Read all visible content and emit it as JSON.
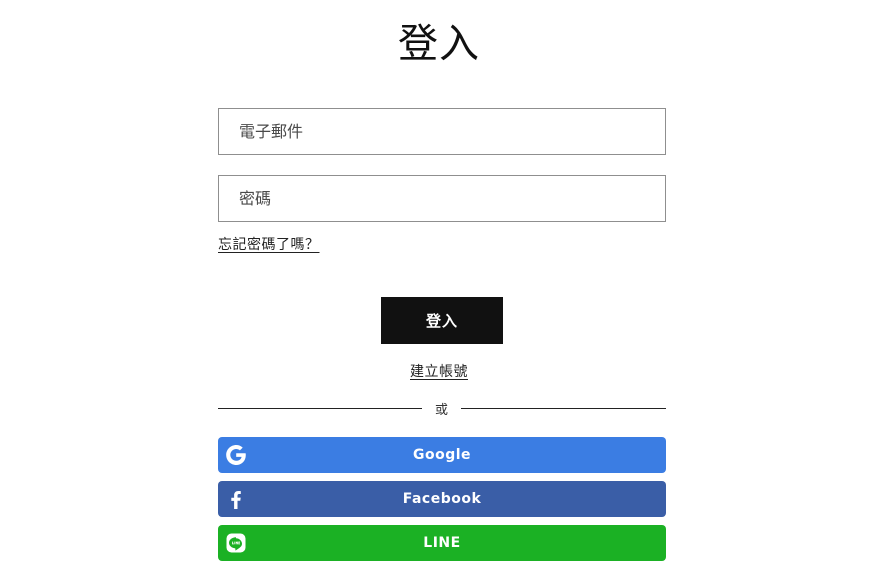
{
  "page": {
    "title": "登入"
  },
  "form": {
    "email_placeholder": "電子郵件",
    "password_placeholder": "密碼",
    "forgot_password": "忘記密碼了嗎？",
    "login_button": "登入",
    "create_account": "建立帳號",
    "divider_text": "或"
  },
  "social": {
    "google": {
      "label": "Google",
      "color": "#3b7de3",
      "icon": "google-icon"
    },
    "facebook": {
      "label": "Facebook",
      "color": "#3a5ea7",
      "icon": "facebook-icon"
    },
    "line": {
      "label": "LINE",
      "color": "#1bb124",
      "icon": "line-icon"
    }
  }
}
